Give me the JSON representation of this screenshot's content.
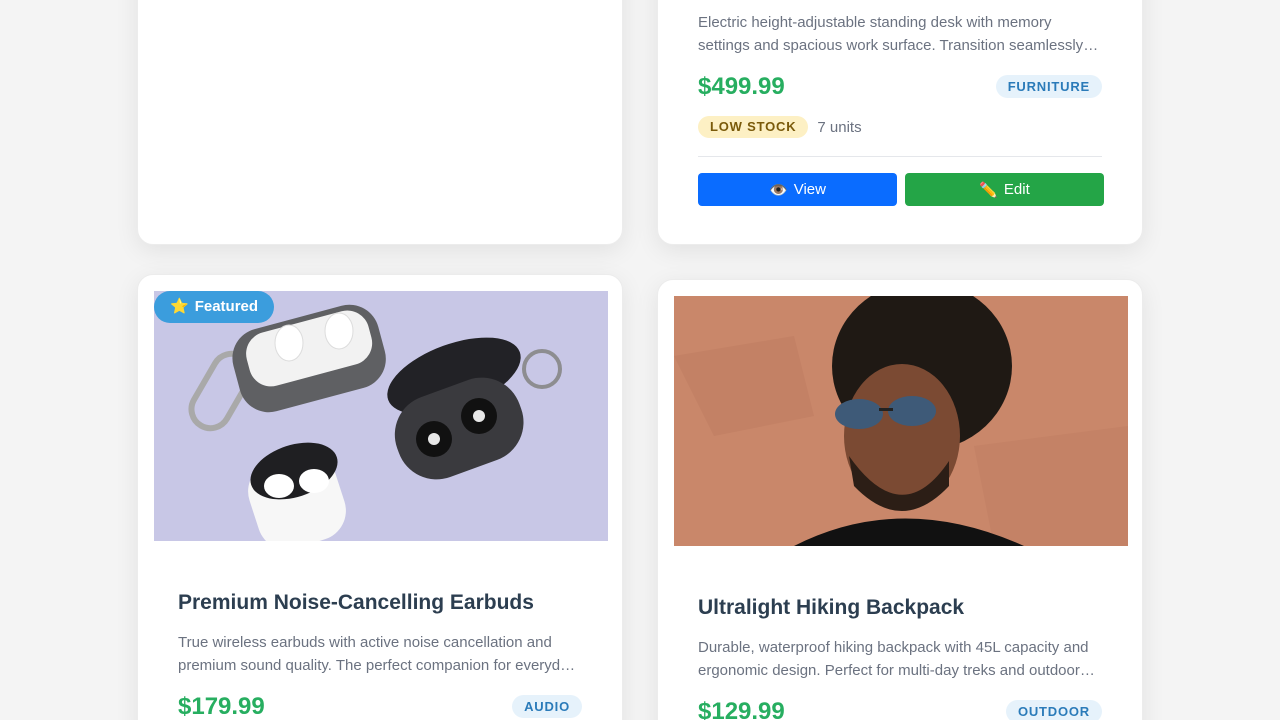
{
  "cards": {
    "top_right": {
      "description": "Electric height-adjustable standing desk with memory settings and spacious work surface. Transition seamlessly between sitting and standing.",
      "price": "$499.99",
      "category": "FURNITURE",
      "stock_status": "LOW STOCK",
      "units": "7 units",
      "view_label": "View",
      "edit_label": "Edit",
      "view_icon": "👁️",
      "edit_icon": "✏️"
    },
    "bottom_left": {
      "featured_label": "Featured",
      "featured_icon": "⭐",
      "title": "Premium Noise-Cancelling Earbuds",
      "description": "True wireless earbuds with active noise cancellation and premium sound quality. The perfect companion for everyday listening.",
      "price": "$179.99",
      "category": "AUDIO"
    },
    "bottom_right": {
      "title": "Ultralight Hiking Backpack",
      "description": "Durable, waterproof hiking backpack with 45L capacity and ergonomic design. Perfect for multi-day treks and outdoor adventures.",
      "price": "$129.99",
      "category": "OUTDOOR"
    }
  },
  "colors": {
    "price_green": "#27ae60",
    "view_blue": "#0a6cff",
    "edit_green": "#24a547",
    "featured_blue": "#3b9ddd"
  }
}
